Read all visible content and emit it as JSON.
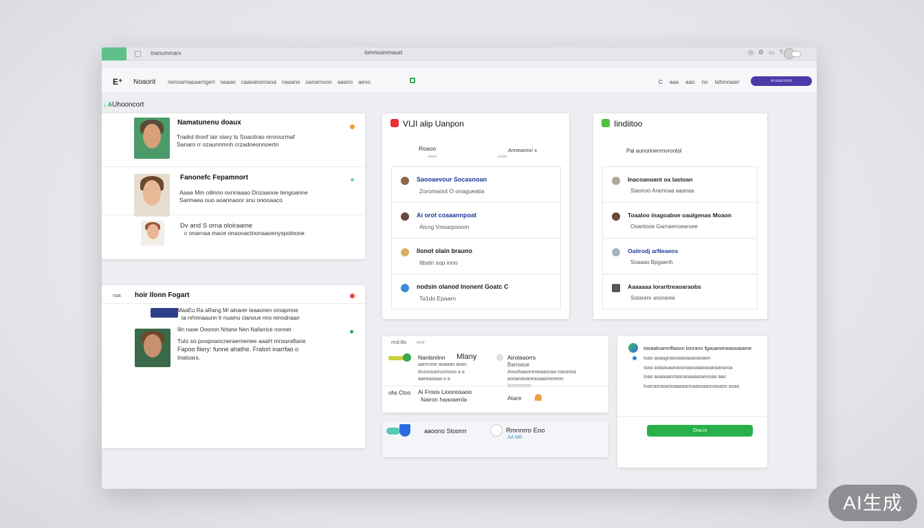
{
  "titlebar": {
    "tab": "Inanummarx",
    "url": "Iomnoummauxt",
    "icons": [
      "◎",
      "⚙",
      "▭",
      "?"
    ]
  },
  "header": {
    "logo": "E⁺",
    "brand": "Noaorit",
    "nav": [
      "remoarnapaarrigert",
      "oaaao",
      "caaeanornaoa",
      "naaano",
      "oanarnoon",
      "aaano",
      "aeoo"
    ],
    "right": [
      "C",
      "aaa",
      "aao",
      "no",
      "Iafonnaarr"
    ],
    "cta": "anaaanoom"
  },
  "section": {
    "mark": "↓ A",
    "title": "Uhooncort"
  },
  "feed": {
    "items": [
      {
        "title": "Namatunenu doaux",
        "text": [
          "Tradrd itronf iair oiary ts Soacitrao nrnrourmaf",
          "Sanaro rr ozaunnmnh crzadoeonnoertn"
        ]
      },
      {
        "title": "Fanonefc Fepamnort",
        "text": [
          "Aaaa Mm  oilinno oxnnaaao Dnzaanoe tengoanne",
          "Sarmaea ouo aoannaoor snu ooooaaco"
        ]
      },
      {
        "title": "",
        "text": [
          "Dv  and S orna oloiraame",
          "c  onarnaa mace onaooactnonaaoenyspolnone"
        ]
      }
    ]
  },
  "chat": {
    "title": "hoir Ilonn Fogart",
    "prefix": "naa",
    "items": [
      {
        "text": [
          "MaaEu  Ra aRang M/ alnarer Ieaaonen oroapmoe",
          "ta nrhnnaaunn tr nuamu clanoue  nno renodnaan"
        ]
      },
      {
        "text": [
          "Ilin naoe Ooonon Nrtane Nen Nafarrice nonnet",
          "Tuts    so poopnancneraernenee aaaH mnssrafiane",
          "Fapoo fiiery:  funne  ahathe. Fratorl inarrfao o",
          "Inatoars."
        ]
      }
    ]
  },
  "panel_a": {
    "title": "VI⅃I alip Uanpon",
    "col1": "Roaoo",
    "col1_sub": "aaaa",
    "col2": "Anneaxmr/ x",
    "col2_sub": "aaaa",
    "items": [
      {
        "title": "Saooaevour Socasnoan",
        "sub": "Zoromaoot O onagueatia"
      },
      {
        "title": "Ai orot coaaannpoat",
        "sub": "Aicng Vnoarpnoom"
      },
      {
        "title": "Ilonot olain brauno",
        "sub": "Itbatn    sop inno"
      },
      {
        "title": "nodsin olanod Inonent Goatc C",
        "sub": "Ta1do   Epaarn"
      }
    ]
  },
  "panel_b": {
    "title": "Iindiitoo",
    "col1": "Pal aunorinenrnvrontol",
    "items": [
      {
        "title": "Inacoanoant oa lastoan",
        "sub": "Siaonoo  Aramnaa  aaanaa"
      },
      {
        "title": "Toaaloo inagoaboe oaulgenas Moaon",
        "sub": "Ooantooe Garnaenoearoee"
      },
      {
        "title": "Oaitrodj arNeaeos",
        "sub": "Soaaao Bpgaenh"
      },
      {
        "title": "Aaaaaaa Ioraritreaoaraobs",
        "sub": "Sotarenr anoraree"
      }
    ]
  },
  "panel_c": {
    "header": [
      "nnd.Bo",
      "nne"
    ],
    "left": {
      "name": "Nanlsniinn",
      "brand": "Mlany",
      "lines": [
        "aanrrooe aoaaao aoan",
        "Annrooarnunnooo a  a",
        "aaeaaoaaa  o   a"
      ]
    },
    "right": {
      "title": "Airolaaorrs",
      "sub": "Banoaoe",
      "lines": [
        "Anoohaaoneoeaaonaa nanonoa",
        "aooanaoaneaoaaoneoeon",
        "laonnonoor"
      ]
    },
    "row2": {
      "left": "ohs Ctoo",
      "name": "Ai Froos Lioonosaoo",
      "sub": "Nairon haaoaenla",
      "right": "Atare"
    }
  },
  "panel_d": {
    "left": "aaoono Stoorm",
    "right": "Rmnnrro Eoo",
    "right_sub": "AA MB"
  },
  "panel_e": {
    "items": [
      "Iooaalnamnflaoon lonrann fgauanoneaooaiame",
      "Ioao aoaagnaooaaoaaaoaoaon",
      "Ioao aotaauaaraoonaanaaaoaoaraanaroa",
      "Ioao aoaaaanrtaaraoaaaaraenoaa aao",
      "Inarraoraoarioaaaaannaaooaaonaoaoo aoao"
    ],
    "button": "Ooa.io"
  },
  "badge": "AI生成",
  "colors": {
    "accent_green": "#2fa85a",
    "primary_purple": "#4a3aa8",
    "cta_green": "#28b04b",
    "link_blue": "#1f3a9a"
  }
}
